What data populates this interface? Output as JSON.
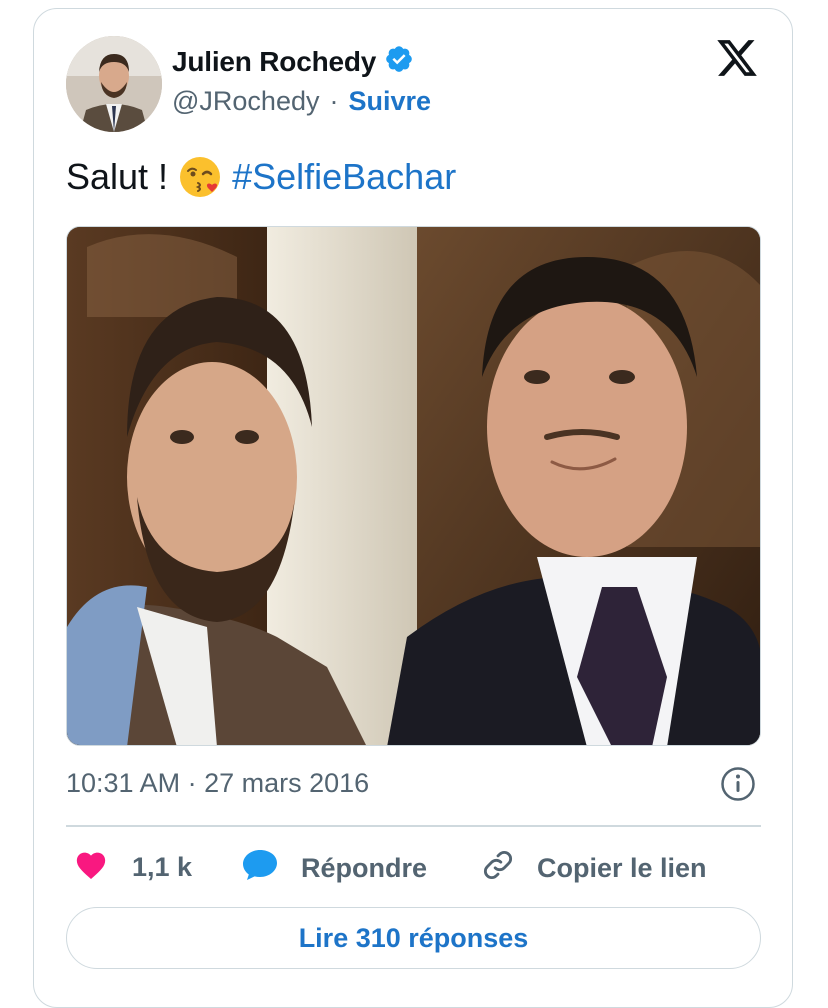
{
  "author": {
    "name": "Julien Rochedy",
    "handle": "@JRochedy",
    "separator": "·",
    "follow_label": "Suivre"
  },
  "tweet": {
    "text": "Salut !",
    "emoji": "😘",
    "hashtag": "#SelfieBachar"
  },
  "meta": {
    "timestamp": "10:31 AM · 27 mars 2016"
  },
  "actions": {
    "likes_count": "1,1 k",
    "reply_label": "Répondre",
    "copy_link_label": "Copier le lien"
  },
  "read_replies_label": "Lire 310 réponses",
  "colors": {
    "accent": "#1d74c8",
    "like": "#f91880",
    "verified": "#1d9bf0",
    "muted": "#536471",
    "border": "#cfd9de"
  },
  "icons": [
    "verified-badge-icon",
    "x-logo-icon",
    "info-icon",
    "heart-icon",
    "reply-bubble-icon",
    "link-icon"
  ]
}
